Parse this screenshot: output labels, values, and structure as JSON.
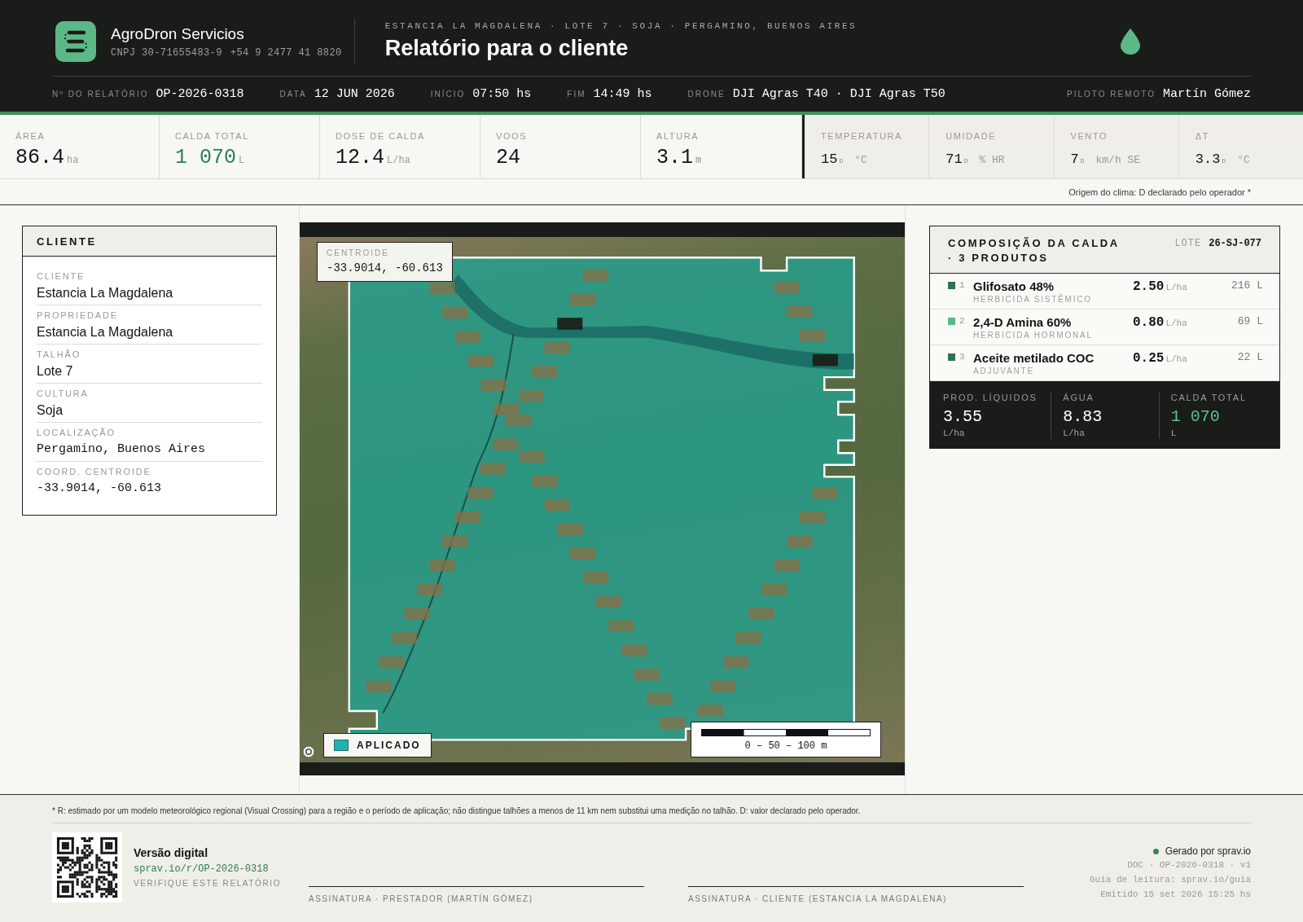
{
  "header": {
    "company_name": "AgroDron Servicios",
    "tax_id": "CNPJ 30-71655483-9",
    "phone": "+54 9 2477 41 8820",
    "breadcrumb": "ESTANCIA LA MAGDALENA · LOTE 7 · SOJA · PERGAMINO, BUENOS AIRES",
    "title": "Relatório para o cliente"
  },
  "meta": [
    {
      "label": "Nº DO RELATÓRIO",
      "value": "OP-2026-0318"
    },
    {
      "label": "DATA",
      "value": "12 JUN 2026"
    },
    {
      "label": "INÍCIO",
      "value": "07:50 hs"
    },
    {
      "label": "FIM",
      "value": "14:49 hs"
    },
    {
      "label": "DRONE",
      "value": "DJI Agras T40 · DJI Agras T50"
    },
    {
      "label": "PILOTO REMOTO",
      "value": "Martín Gómez"
    }
  ],
  "stats": [
    {
      "label": "ÁREA",
      "value": "86.4",
      "unit": "ha",
      "kind": "plain"
    },
    {
      "label": "CALDA TOTAL",
      "value": "1 070",
      "unit": "L",
      "kind": "accent"
    },
    {
      "label": "DOSE DE CALDA",
      "value": "12.4",
      "unit": "L/ha",
      "kind": "plain"
    },
    {
      "label": "VOOS",
      "value": "24",
      "kind": "plain"
    },
    {
      "label": "ALTURA",
      "value": "3.1",
      "unit": "m",
      "kind": "plain"
    }
  ],
  "weather": [
    {
      "label": "TEMPERATURA",
      "value": "15",
      "source": "D",
      "unit": "°C"
    },
    {
      "label": "UMIDADE",
      "value": "71",
      "source": "D",
      "unit": "% HR"
    },
    {
      "label": "VENTO",
      "value": "7",
      "source": "D",
      "unit": "km/h SE"
    },
    {
      "label": "ΔT",
      "value": "3.3",
      "source": "D",
      "unit": "°C"
    }
  ],
  "weather_note": "Origem do clima: D declarado pelo operador *",
  "client_card": {
    "title": "CLIENTE",
    "fields": [
      {
        "label": "CLIENTE",
        "value": "Estancia La Magdalena",
        "kind": "text"
      },
      {
        "label": "PROPRIEDADE",
        "value": "Estancia La Magdalena",
        "kind": "text"
      },
      {
        "label": "TALHÃO",
        "value": "Lote 7",
        "kind": "text"
      },
      {
        "label": "CULTURA",
        "value": "Soja",
        "kind": "text"
      },
      {
        "label": "LOCALIZAÇÃO",
        "value": "Pergamino, Buenos Aires",
        "kind": "mono"
      },
      {
        "label": "COORD. CENTROIDE",
        "value": "-33.9014, -60.613",
        "kind": "mono"
      }
    ]
  },
  "map": {
    "centroid_label": "CENTROIDE",
    "centroid_value": "-33.9014, -60.613",
    "legend": "APLICADO",
    "scale": "0 – 50 – 100 m"
  },
  "composition": {
    "title": "COMPOSIÇÃO DA CALDA · 3 PRODUTOS",
    "batch_label": "LOTE",
    "batch": "26-SJ-077",
    "products": [
      {
        "index": "1",
        "name": "Glifosato 48%",
        "category": "HERBICIDA SISTÊMICO",
        "dose": "2.50",
        "dose_unit": "L/ha",
        "total": "216 L",
        "color": "#2e7352"
      },
      {
        "index": "2",
        "name": "2,4-D Amina 60%",
        "category": "HERBICIDA HORMONAL",
        "dose": "0.80",
        "dose_unit": "L/ha",
        "total": "69 L",
        "color": "#5cb887"
      },
      {
        "index": "3",
        "name": "Aceite metilado COC",
        "category": "ADJUVANTE",
        "dose": "0.25",
        "dose_unit": "L/ha",
        "total": "22 L",
        "color": "#2e7352"
      }
    ],
    "summary": [
      {
        "label": "PROD. LÍQUIDOS",
        "value": "3.55",
        "unit": "L/ha",
        "kind": "plain"
      },
      {
        "label": "ÁGUA",
        "value": "8.83",
        "unit": "L/ha",
        "kind": "plain"
      },
      {
        "label": "CALDA TOTAL",
        "value": "1 070",
        "unit": "L",
        "kind": "accent"
      }
    ]
  },
  "footer": {
    "footnote": "* R: estimado por um modelo meteorológico regional (Visual Crossing) para a região e o período de aplicação; não distingue talhões a menos de 11 km nem substitui uma medição no talhão. D: valor declarado pelo operador.",
    "digital_title": "Versão digital",
    "digital_link": "sprav.io/r/OP-2026-0318",
    "digital_caption": "VERIFIQUE ESTE RELATÓRIO",
    "signatures": [
      "ASSINATURA · PRESTADOR (MARTÍN GÓMEZ)",
      "ASSINATURA · CLIENTE (ESTANCIA LA MAGDALENA)"
    ],
    "generator": "Gerado por sprav.io",
    "doc_lines": [
      "DOC · OP-2026-0318 · v1",
      "Guia de leitura: sprav.io/guia",
      "Emitido 15 set 2026 15:25 hs"
    ]
  }
}
